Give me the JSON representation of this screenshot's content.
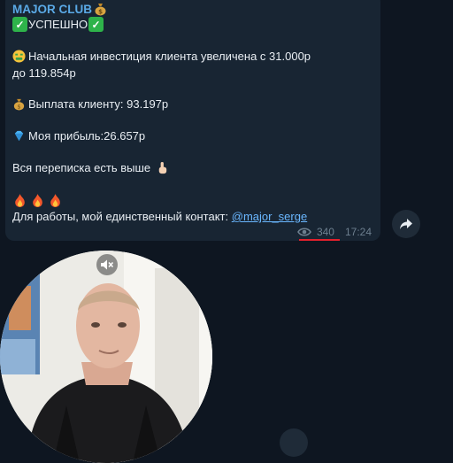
{
  "post": {
    "channel_name": "MAJOR CLUB",
    "status_text": "УСПЕШНО",
    "line_investment_1": "Начальная инвестиция клиента увеличена с 31.000р",
    "line_investment_2": "до 119.854р",
    "line_payout": "Выплата клиенту: 93.197р",
    "line_profit": "Моя прибыль:26.657р",
    "line_correspondence": "Вся переписка есть выше",
    "contact_prefix": "Для работы, мой единственный контакт: ",
    "contact_link": "@major_serge",
    "views": "340",
    "time": "17:24"
  },
  "icons": {
    "money_bag": "money-bag-icon",
    "check": "check-mark-icon",
    "money_face": "money-mouth-face-icon",
    "diamond": "gem-icon",
    "pointing": "point-up-icon",
    "fire": "fire-icon",
    "eye": "eye-icon",
    "share": "share-arrow-icon",
    "mute": "muted-speaker-icon"
  },
  "colors": {
    "background": "#0e1621",
    "bubble": "#182533",
    "channel_name": "#5aa9e6",
    "link": "#6ab7ff",
    "views_underline": "#e2202c"
  }
}
